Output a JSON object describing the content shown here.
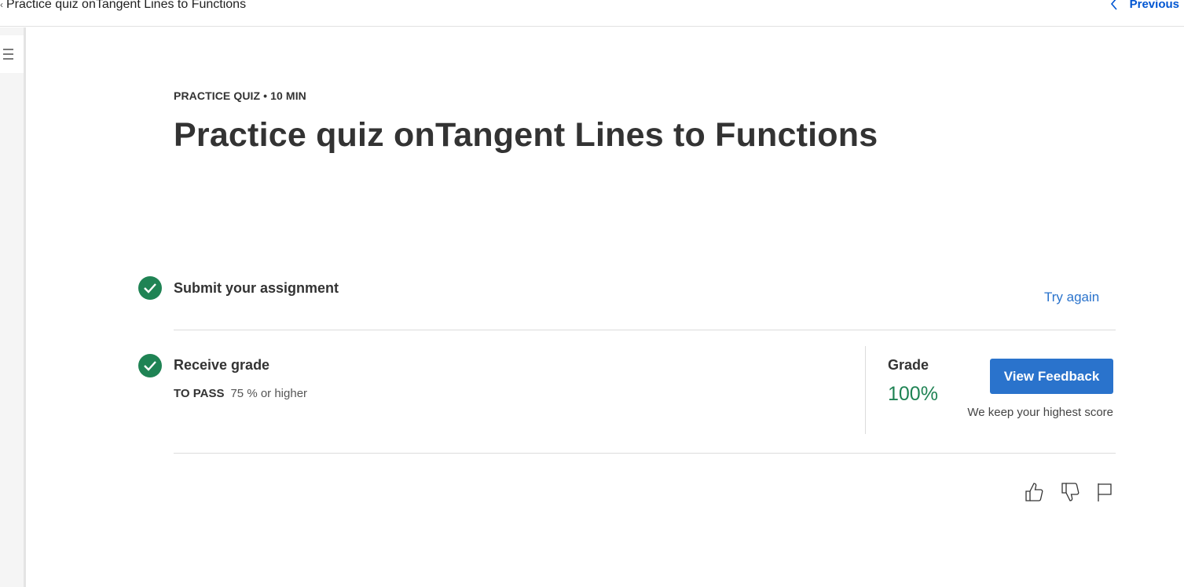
{
  "topbar": {
    "breadcrumb_title": "Practice quiz onTangent Lines to Functions",
    "previous_label": "Previous"
  },
  "quiz": {
    "meta": "PRACTICE QUIZ • 10 MIN",
    "title": "Practice quiz onTangent Lines to Functions"
  },
  "steps": {
    "submit_title": "Submit your assignment",
    "try_again_label": "Try again",
    "receive_title": "Receive grade",
    "to_pass_label": "TO PASS",
    "to_pass_value": "75 % or higher"
  },
  "grade": {
    "label": "Grade",
    "value": "100%",
    "view_feedback_label": "View Feedback",
    "note": "We keep your highest score"
  },
  "icons": {
    "like": "thumbs-up-icon",
    "dislike": "thumbs-down-icon",
    "report": "flag-icon",
    "menu": "menu-icon",
    "check": "check-circle-icon"
  },
  "colors": {
    "accent": "#2a73cc",
    "link": "#0056d2",
    "success": "#1f8354"
  }
}
